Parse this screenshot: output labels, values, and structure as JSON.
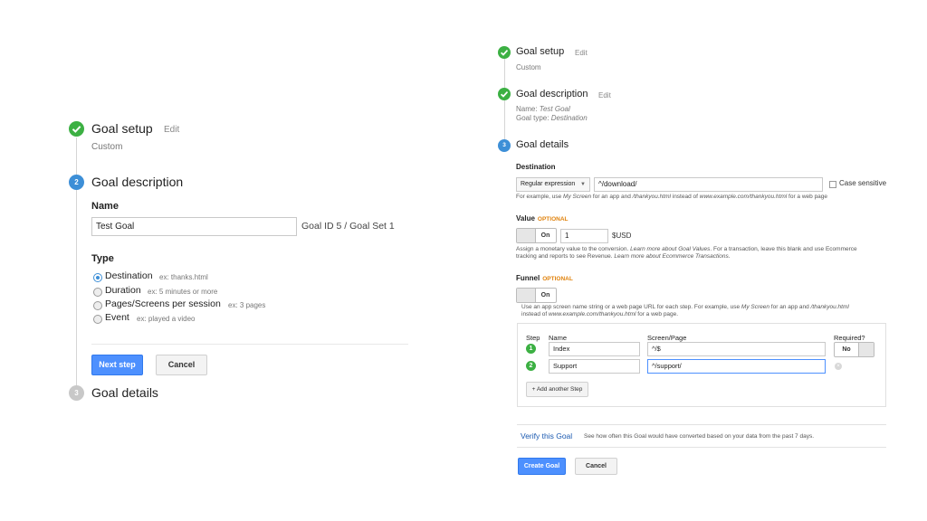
{
  "left": {
    "goal_setup": {
      "title": "Goal setup",
      "edit": "Edit",
      "value": "Custom"
    },
    "goal_description": {
      "step_num": "2",
      "title": "Goal description"
    },
    "name_label": "Name",
    "name_value": "Test Goal",
    "goal_id": "Goal ID 5 / Goal Set 1",
    "type_label": "Type",
    "types": [
      {
        "label": "Destination",
        "example": "ex: thanks.html",
        "selected": true
      },
      {
        "label": "Duration",
        "example": "ex: 5 minutes or more",
        "selected": false
      },
      {
        "label": "Pages/Screens per session",
        "example": "ex: 3 pages",
        "selected": false
      },
      {
        "label": "Event",
        "example": "ex: played a video",
        "selected": false
      }
    ],
    "next_step": "Next step",
    "cancel": "Cancel",
    "goal_details": {
      "step_num": "3",
      "title": "Goal details"
    }
  },
  "right": {
    "goal_setup": {
      "title": "Goal setup",
      "edit": "Edit",
      "value": "Custom"
    },
    "goal_description": {
      "title": "Goal description",
      "edit": "Edit",
      "name_prefix": "Name: ",
      "name_value": "Test Goal",
      "type_prefix": "Goal type: ",
      "type_value": "Destination"
    },
    "goal_details": {
      "step_num": "3",
      "title": "Goal details"
    },
    "destination": {
      "label": "Destination",
      "match_type": "Regular expression",
      "value": "^/download/",
      "case_sensitive": "Case sensitive",
      "help_1": "For example, use ",
      "help_2": "My Screen",
      "help_3": " for an app and ",
      "help_4": "/thankyou.html",
      "help_5": " instead of ",
      "help_6": "www.example.com/thankyou.html",
      "help_7": " for a web page"
    },
    "value_section": {
      "label": "Value",
      "optional": "OPTIONAL",
      "toggle": "On",
      "amount": "1",
      "currency": "$USD",
      "help_line1_a": "Assign a monetary value to the conversion. ",
      "help_line1_b": "Learn more about ",
      "help_line1_link": "Goal Values",
      "help_line1_c": ". For a transaction, leave this blank and use Ecommerce",
      "help_line2_a": "tracking and reports to see Revenue. ",
      "help_line2_b": "Learn more about ",
      "help_line2_link": "Ecommerce Transactions",
      "help_line2_c": "."
    },
    "funnel": {
      "label": "Funnel",
      "optional": "OPTIONAL",
      "toggle": "On",
      "help_line1_a": "Use an app screen name string or a web page URL for each step. For example, use ",
      "help_line1_b": "My Screen",
      "help_line1_c": " for an app and ",
      "help_line1_d": "/thankyou.html",
      "help_line2_a": "instead of ",
      "help_line2_b": "www.example.com/thankyou.html",
      "help_line2_c": " for a web page.",
      "col_step": "Step",
      "col_name": "Name",
      "col_screen": "Screen/Page",
      "col_required": "Required?",
      "rows": [
        {
          "num": "1",
          "name": "Index",
          "screen": "^/$"
        },
        {
          "num": "2",
          "name": "Support",
          "screen": "^/support/"
        }
      ],
      "required_toggle": "No",
      "add_step": "+ Add another Step"
    },
    "verify": {
      "link": "Verify this Goal",
      "text": "See how often this Goal would have converted based on your data from the past 7 days."
    },
    "create_goal": "Create Goal",
    "cancel": "Cancel",
    "colors": {
      "check": "#3cb043",
      "step_blue": "#3d8fd7",
      "primary": "#4d90fe",
      "link": "#1a59b0",
      "optional": "#e0820c"
    }
  }
}
